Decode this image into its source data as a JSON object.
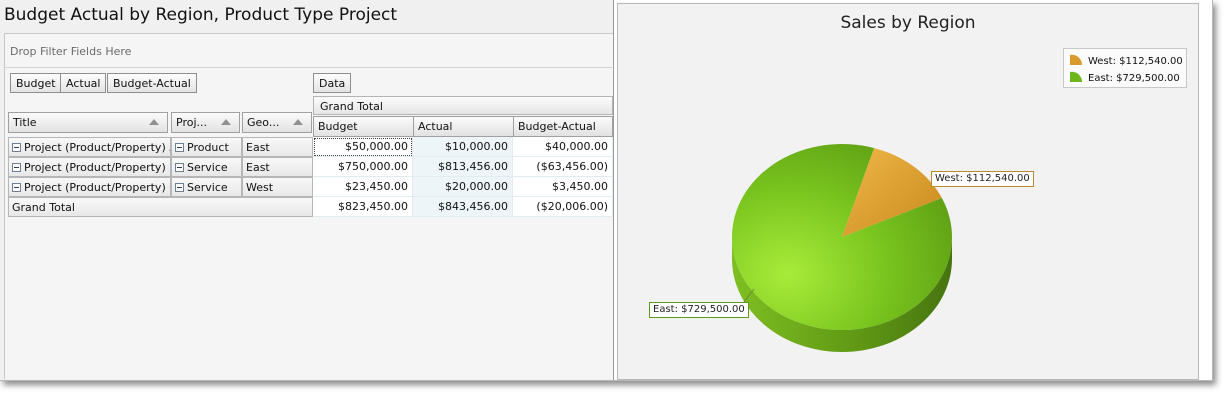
{
  "report_title": "Budget  Actual by Region, Product Type  Project",
  "pivot": {
    "filter_placeholder": "Drop Filter Fields Here",
    "data_fields": [
      "Budget",
      "Actual",
      "Budget-Actual"
    ],
    "data_button": "Data",
    "grand_total_header": "Grand Total",
    "row_headers": [
      "Title",
      "Proj...",
      "Geo..."
    ],
    "value_headers": [
      "Budget",
      "Actual",
      "Budget-Actual"
    ],
    "rows": [
      {
        "title": "Project (Product/Property) A",
        "type": "Product",
        "geo": "East",
        "budget": "$50,000.00",
        "actual": "$10,000.00",
        "diff": "$40,000.00"
      },
      {
        "title": "Project (Product/Property) B",
        "type": "Service",
        "geo": "East",
        "budget": "$750,000.00",
        "actual": "$813,456.00",
        "diff": "($63,456.00)"
      },
      {
        "title": "Project (Product/Property) C",
        "type": "Service",
        "geo": "West",
        "budget": "$23,450.00",
        "actual": "$20,000.00",
        "diff": "$3,450.00"
      }
    ],
    "grand_total_row": {
      "label": "Grand Total",
      "budget": "$823,450.00",
      "actual": "$843,456.00",
      "diff": "($20,006.00)"
    }
  },
  "chart_data": {
    "type": "pie",
    "title": "Sales by Region",
    "categories": [
      "West",
      "East"
    ],
    "values": [
      112540,
      729500
    ],
    "labels": [
      "West: $112,540.00",
      "East: $729,500.00"
    ],
    "colors": [
      "#e0a030",
      "#6fb51c"
    ],
    "legend_position": "top-right"
  }
}
